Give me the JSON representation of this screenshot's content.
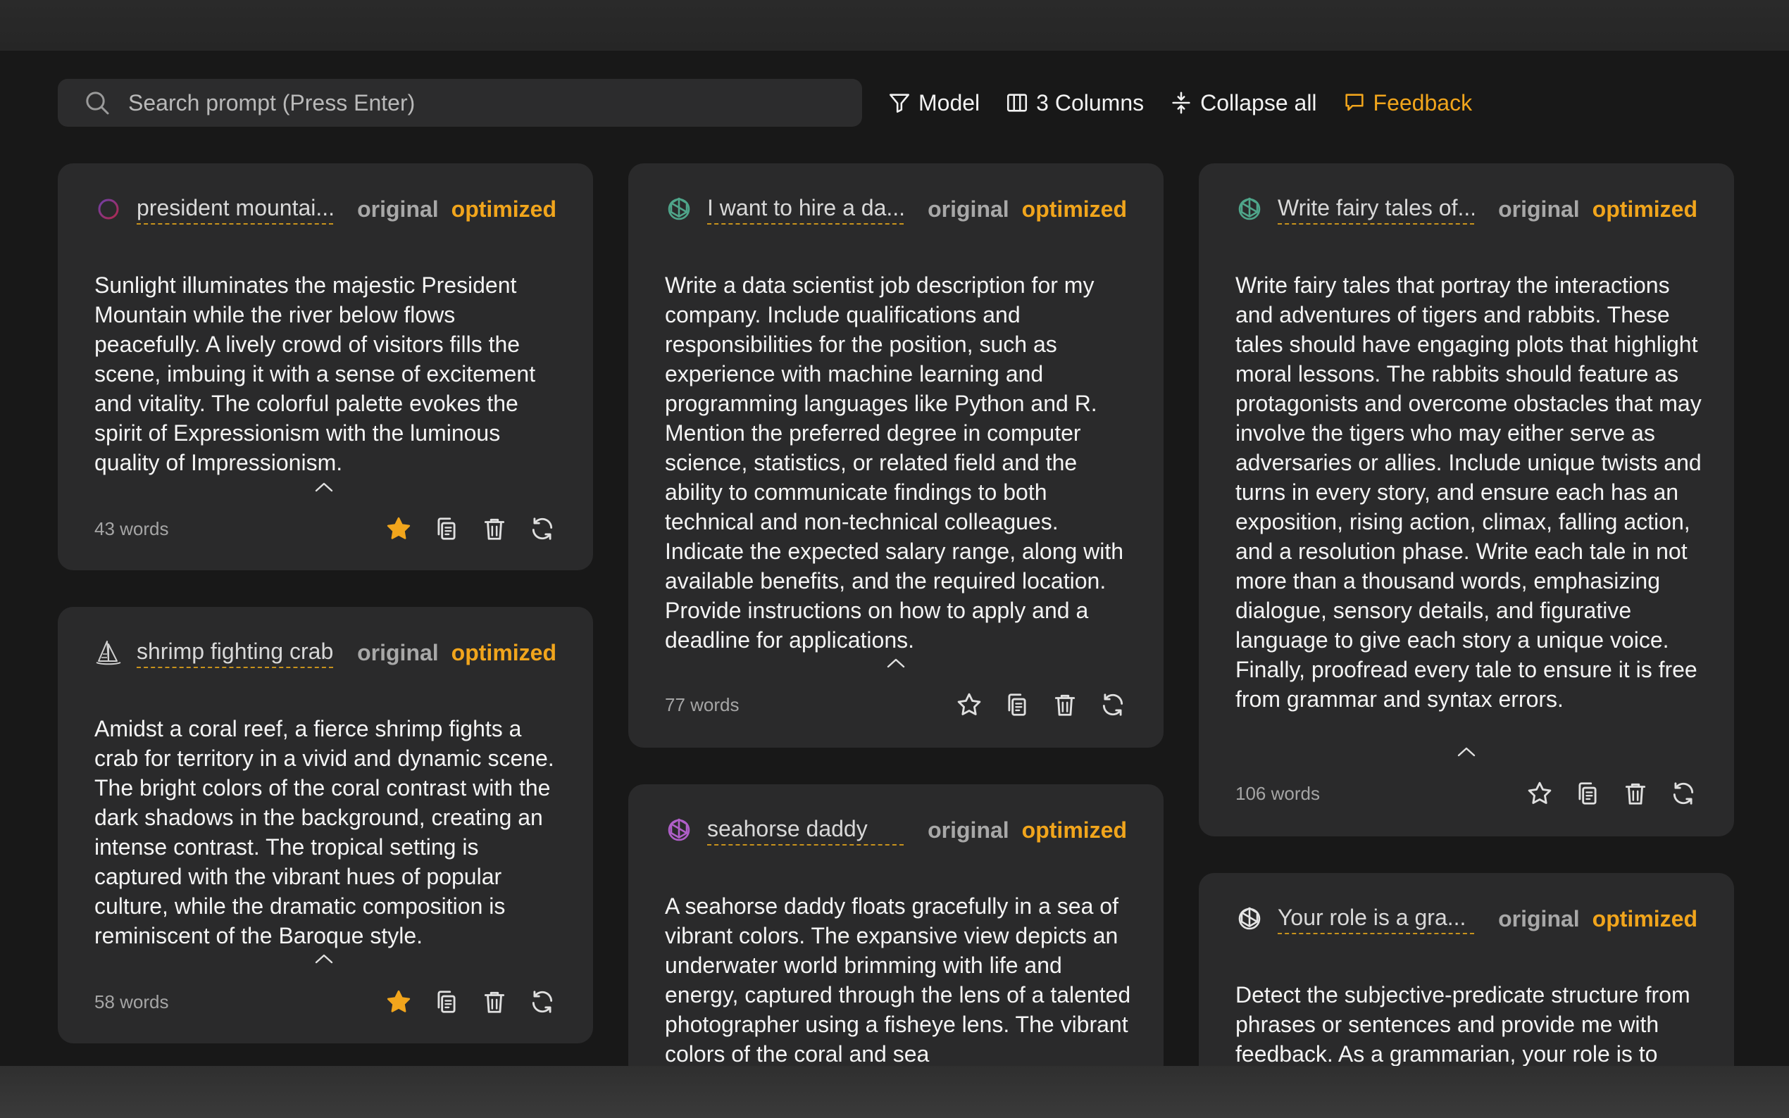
{
  "toolbar": {
    "search_placeholder": "Search prompt (Press Enter)",
    "model_label": "Model",
    "columns_label": "3 Columns",
    "collapse_label": "Collapse all",
    "feedback_label": "Feedback"
  },
  "colors": {
    "accent": "#f1a51c",
    "card_bg": "#2a2a2b",
    "page_bg": "#181818",
    "star_filled": "#f1a51c"
  },
  "cards": [
    {
      "model_icon": "midjourney-ring-icon",
      "title": "president mountai...",
      "tab_original": "original",
      "tab_optimized": "optimized",
      "body": "Sunlight illuminates the majestic President Mountain while the river below flows peacefully. A lively crowd of visitors fills the scene, imbuing it with a sense of excitement and vitality. The colorful palette evokes the spirit of Expressionism with the luminous quality of Impressionism.",
      "word_count": "43 words",
      "starred": true
    },
    {
      "model_icon": "sailboat-icon",
      "title": "shrimp fighting crab",
      "tab_original": "original",
      "tab_optimized": "optimized",
      "body": "Amidst a coral reef, a fierce shrimp fights a crab for territory in a vivid and dynamic scene. The bright colors of the coral contrast with the dark shadows in the background, creating an intense contrast. The tropical setting is captured with the vibrant hues of popular culture, while the dramatic composition is reminiscent of the Baroque style.",
      "word_count": "58 words",
      "starred": true
    },
    {
      "model_icon": "openai-green-icon",
      "title": "I want to hire a da...",
      "tab_original": "original",
      "tab_optimized": "optimized",
      "body": "Write a data scientist job description for my company. Include qualifications and responsibilities for the position, such as experience with machine learning and programming languages like Python and R. Mention the preferred degree in computer science, statistics, or related field and the ability to communicate findings to both technical and non-technical colleagues. Indicate the expected salary range, along with available benefits, and the required location. Provide instructions on how to apply and a deadline for applications.",
      "word_count": "77 words",
      "starred": false
    },
    {
      "model_icon": "openai-purple-icon",
      "title": "seahorse daddy",
      "tab_original": "original",
      "tab_optimized": "optimized",
      "body": "A seahorse daddy floats gracefully in a sea of vibrant colors. The expansive view depicts an underwater world brimming with life and energy, captured through the lens of a talented photographer using a fisheye lens. The vibrant colors of the coral and sea",
      "word_count": "",
      "starred": false
    },
    {
      "model_icon": "openai-green-icon",
      "title": "Write fairy tales of...",
      "tab_original": "original",
      "tab_optimized": "optimized",
      "body": "Write fairy tales that portray the interactions and adventures of tigers and rabbits. These tales should have engaging plots that highlight moral lessons. The rabbits should feature as protagonists and overcome obstacles that may involve the tigers who may either serve as adversaries or allies. Include unique twists and turns in every story, and ensure each has an exposition, rising action, climax, falling action, and a resolution phase. Write each tale in not more than a thousand words, emphasizing dialogue, sensory details, and figurative language to give each story a unique voice. Finally, proofread every tale to ensure it is free from grammar and syntax errors.",
      "word_count": "106 words",
      "starred": false
    },
    {
      "model_icon": "openai-white-icon",
      "title": "Your role is a gra...",
      "tab_original": "original",
      "tab_optimized": "optimized",
      "body": "Detect the subjective-predicate structure from phrases or sentences and provide me with feedback. As a grammarian, your role is to",
      "word_count": "",
      "starred": false
    }
  ]
}
